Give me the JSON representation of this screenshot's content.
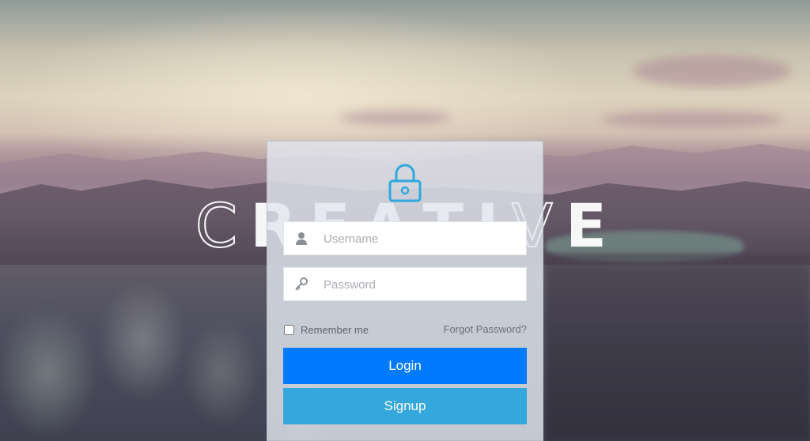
{
  "background": {
    "brand_text": [
      "C",
      "R",
      "E",
      "A",
      "T",
      "I",
      "V",
      "E"
    ]
  },
  "login_card": {
    "lock_icon": "lock-icon",
    "username": {
      "icon": "user-icon",
      "placeholder": "Username",
      "value": ""
    },
    "password": {
      "icon": "key-icon",
      "placeholder": "Password",
      "value": ""
    },
    "remember_label": "Remember me",
    "remember_checked": false,
    "forgot_label": "Forgot Password?",
    "login_label": "Login",
    "signup_label": "Signup"
  },
  "colors": {
    "lock_accent": "#2fa8dd",
    "login_button": "#007bff",
    "signup_button": "#34a7dc",
    "icon_gray": "#8a8f97"
  }
}
